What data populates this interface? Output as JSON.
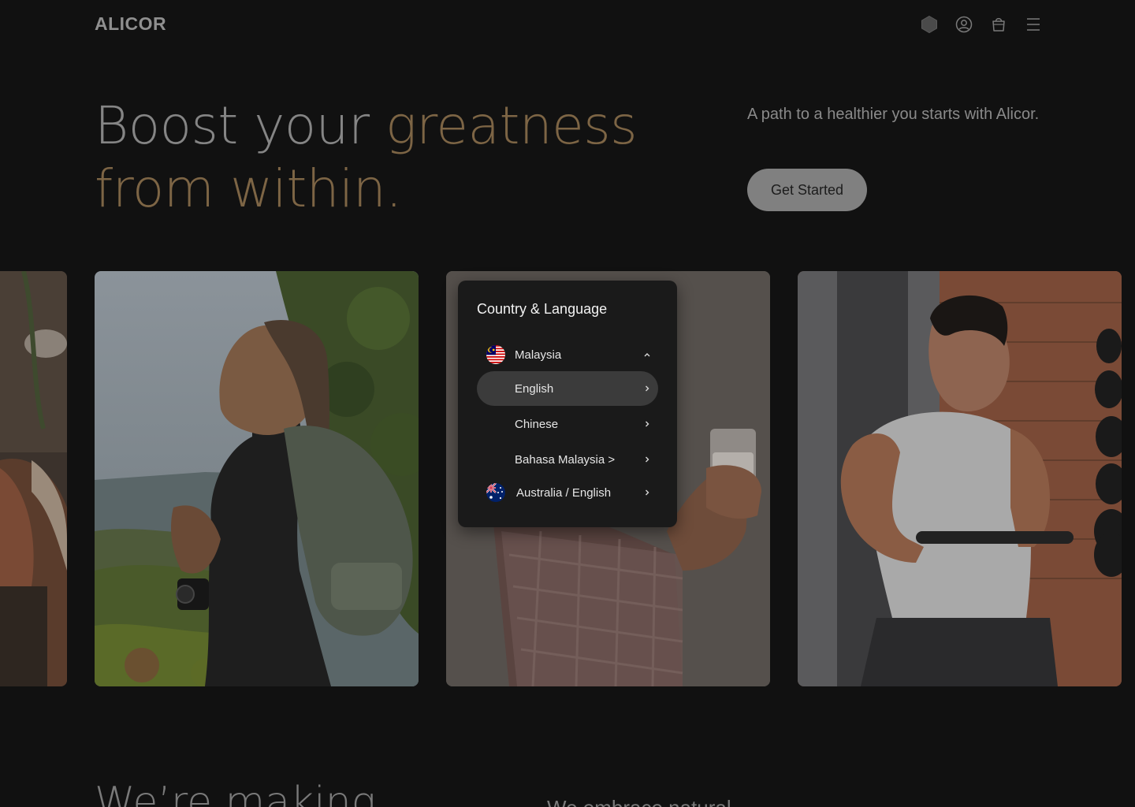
{
  "header": {
    "logo": "ALICOR",
    "icons": [
      "hexagon-icon",
      "user-icon",
      "bag-icon",
      "menu-icon"
    ]
  },
  "hero": {
    "title_part1": "Boost your ",
    "title_accent1": "greatness",
    "title_accent2": "from within.",
    "copy": "A path to a healthier you starts with Alicor.",
    "cta_label": "Get Started"
  },
  "popup": {
    "title": "Country & Language",
    "countries": [
      {
        "name": "Malaysia",
        "expanded": true,
        "languages": [
          {
            "label": "English",
            "selected": true
          },
          {
            "label": "Chinese",
            "selected": false
          },
          {
            "label": "Bahasa Malaysia >",
            "selected": false
          }
        ]
      },
      {
        "name": "Australia / English",
        "expanded": false
      }
    ]
  },
  "bottom": {
    "title": "We’re making",
    "subtitle": "We embrace natural"
  },
  "colors": {
    "background": "#111111",
    "accent": "#7d6545",
    "muted_text": "#858585",
    "button": "#808080",
    "popup_bg": "#1a1a1a",
    "popup_selected": "#3b3b3b"
  }
}
